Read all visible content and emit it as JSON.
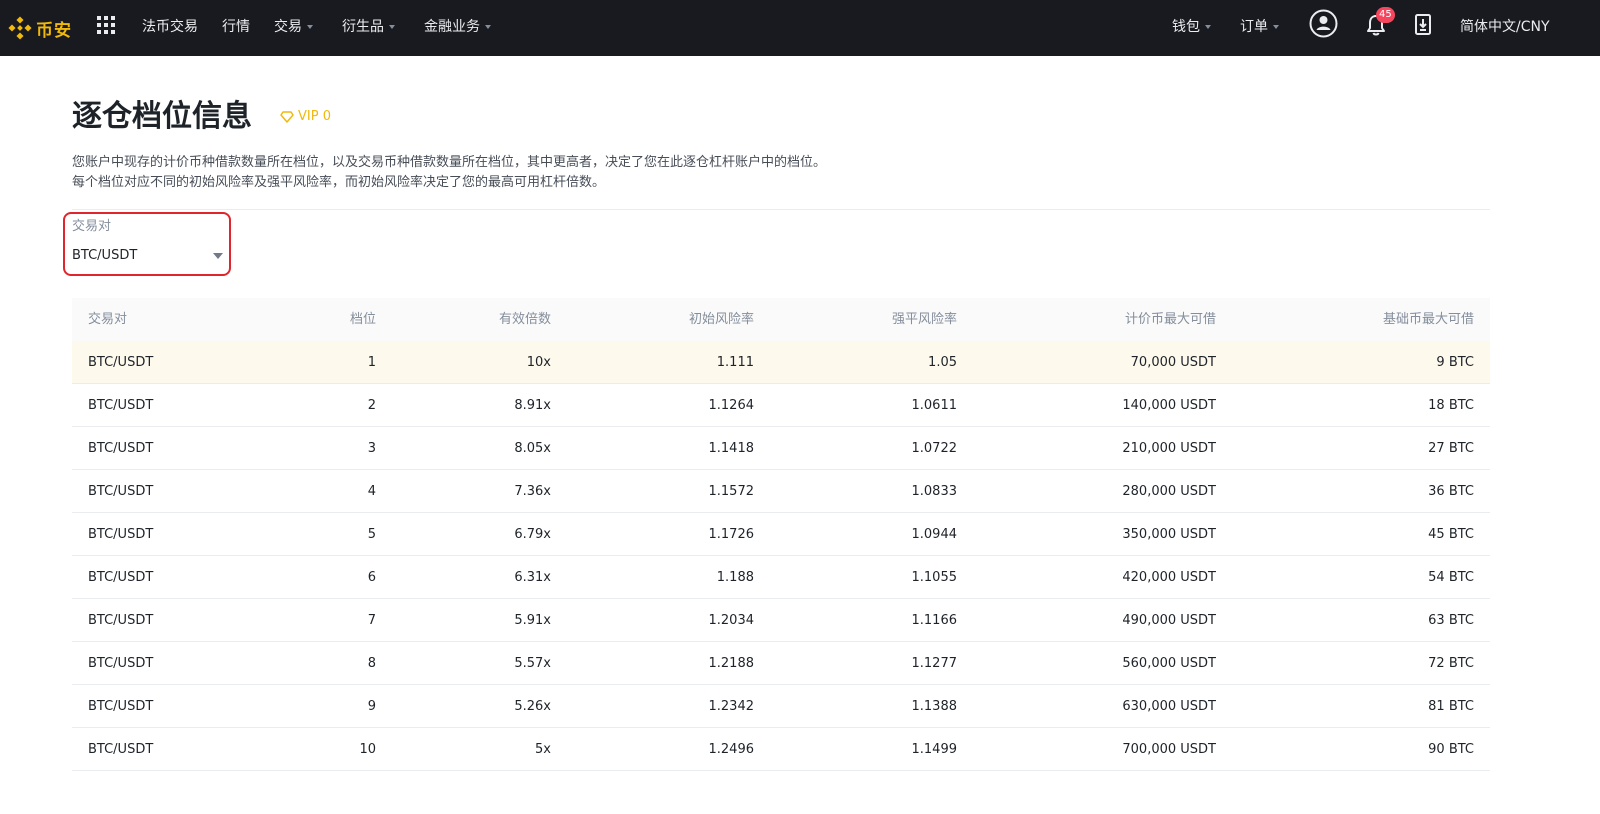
{
  "colors": {
    "accent": "#f0b90b",
    "nav_bg": "#181a20",
    "highlight_row": "#fdf9ec",
    "selector_border": "#e0262c",
    "notification_badge": "#f6465d"
  },
  "nav": {
    "logo_text": "币安",
    "logo_icon": "binance-diamond-icon",
    "apps_icon": "grid-icon",
    "items": [
      {
        "label": "法币交易"
      },
      {
        "label": "行情"
      },
      {
        "label": "交易",
        "dropdown": true
      },
      {
        "label": "衍生品",
        "dropdown": true
      },
      {
        "label": "金融业务",
        "dropdown": true
      }
    ],
    "right": {
      "wallet": "钱包",
      "orders": "订单",
      "account_icon": "user-icon",
      "notification_icon": "bell-icon",
      "notification_count": "45",
      "download_icon": "download-icon",
      "language": "简体中文/CNY"
    }
  },
  "page": {
    "title": "逐仓档位信息",
    "vip_label": "VIP 0",
    "vip_icon": "diamond-icon",
    "description_lines": [
      "您账户中现存的计价币种借款数量所在档位，以及交易币种借款数量所在档位，其中更高者，决定了您在此逐仓杠杆账户中的档位。",
      "每个档位对应不同的初始风险率及强平风险率，而初始风险率决定了您的最高可用杠杆倍数。"
    ]
  },
  "selector": {
    "label": "交易对",
    "value": "BTC/USDT"
  },
  "table": {
    "columns": [
      "交易对",
      "档位",
      "有效倍数",
      "初始风险率",
      "强平风险率",
      "计价币最大可借",
      "基础币最大可借"
    ],
    "highlighted_row": 0,
    "rows": [
      [
        "BTC/USDT",
        "1",
        "10x",
        "1.111",
        "1.05",
        "70,000 USDT",
        "9 BTC"
      ],
      [
        "BTC/USDT",
        "2",
        "8.91x",
        "1.1264",
        "1.0611",
        "140,000 USDT",
        "18 BTC"
      ],
      [
        "BTC/USDT",
        "3",
        "8.05x",
        "1.1418",
        "1.0722",
        "210,000 USDT",
        "27 BTC"
      ],
      [
        "BTC/USDT",
        "4",
        "7.36x",
        "1.1572",
        "1.0833",
        "280,000 USDT",
        "36 BTC"
      ],
      [
        "BTC/USDT",
        "5",
        "6.79x",
        "1.1726",
        "1.0944",
        "350,000 USDT",
        "45 BTC"
      ],
      [
        "BTC/USDT",
        "6",
        "6.31x",
        "1.188",
        "1.1055",
        "420,000 USDT",
        "54 BTC"
      ],
      [
        "BTC/USDT",
        "7",
        "5.91x",
        "1.2034",
        "1.1166",
        "490,000 USDT",
        "63 BTC"
      ],
      [
        "BTC/USDT",
        "8",
        "5.57x",
        "1.2188",
        "1.1277",
        "560,000 USDT",
        "72 BTC"
      ],
      [
        "BTC/USDT",
        "9",
        "5.26x",
        "1.2342",
        "1.1388",
        "630,000 USDT",
        "81 BTC"
      ],
      [
        "BTC/USDT",
        "10",
        "5x",
        "1.2496",
        "1.1499",
        "700,000 USDT",
        "90 BTC"
      ]
    ]
  }
}
